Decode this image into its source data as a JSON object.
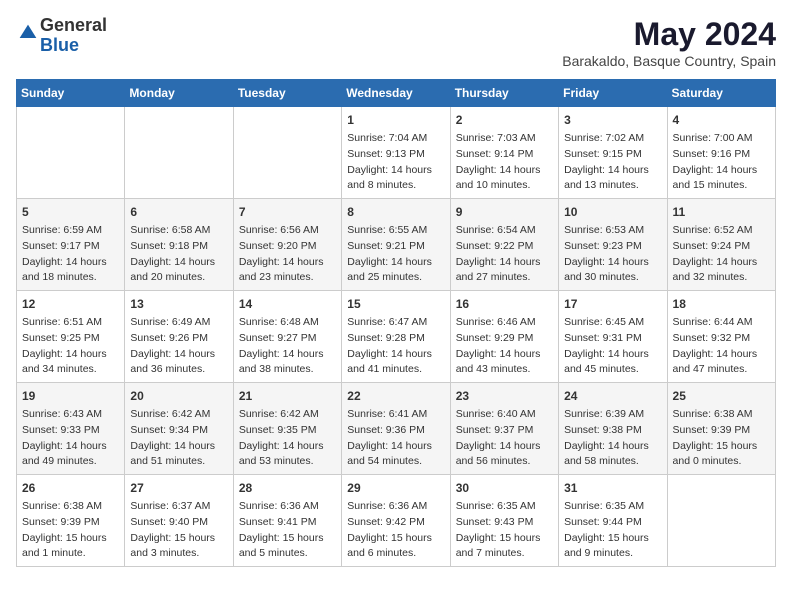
{
  "header": {
    "logo_general": "General",
    "logo_blue": "Blue",
    "title": "May 2024",
    "subtitle": "Barakaldo, Basque Country, Spain"
  },
  "days_of_week": [
    "Sunday",
    "Monday",
    "Tuesday",
    "Wednesday",
    "Thursday",
    "Friday",
    "Saturday"
  ],
  "weeks": [
    [
      {
        "day": "",
        "content": ""
      },
      {
        "day": "",
        "content": ""
      },
      {
        "day": "",
        "content": ""
      },
      {
        "day": "1",
        "content": "Sunrise: 7:04 AM\nSunset: 9:13 PM\nDaylight: 14 hours\nand 8 minutes."
      },
      {
        "day": "2",
        "content": "Sunrise: 7:03 AM\nSunset: 9:14 PM\nDaylight: 14 hours\nand 10 minutes."
      },
      {
        "day": "3",
        "content": "Sunrise: 7:02 AM\nSunset: 9:15 PM\nDaylight: 14 hours\nand 13 minutes."
      },
      {
        "day": "4",
        "content": "Sunrise: 7:00 AM\nSunset: 9:16 PM\nDaylight: 14 hours\nand 15 minutes."
      }
    ],
    [
      {
        "day": "5",
        "content": "Sunrise: 6:59 AM\nSunset: 9:17 PM\nDaylight: 14 hours\nand 18 minutes."
      },
      {
        "day": "6",
        "content": "Sunrise: 6:58 AM\nSunset: 9:18 PM\nDaylight: 14 hours\nand 20 minutes."
      },
      {
        "day": "7",
        "content": "Sunrise: 6:56 AM\nSunset: 9:20 PM\nDaylight: 14 hours\nand 23 minutes."
      },
      {
        "day": "8",
        "content": "Sunrise: 6:55 AM\nSunset: 9:21 PM\nDaylight: 14 hours\nand 25 minutes."
      },
      {
        "day": "9",
        "content": "Sunrise: 6:54 AM\nSunset: 9:22 PM\nDaylight: 14 hours\nand 27 minutes."
      },
      {
        "day": "10",
        "content": "Sunrise: 6:53 AM\nSunset: 9:23 PM\nDaylight: 14 hours\nand 30 minutes."
      },
      {
        "day": "11",
        "content": "Sunrise: 6:52 AM\nSunset: 9:24 PM\nDaylight: 14 hours\nand 32 minutes."
      }
    ],
    [
      {
        "day": "12",
        "content": "Sunrise: 6:51 AM\nSunset: 9:25 PM\nDaylight: 14 hours\nand 34 minutes."
      },
      {
        "day": "13",
        "content": "Sunrise: 6:49 AM\nSunset: 9:26 PM\nDaylight: 14 hours\nand 36 minutes."
      },
      {
        "day": "14",
        "content": "Sunrise: 6:48 AM\nSunset: 9:27 PM\nDaylight: 14 hours\nand 38 minutes."
      },
      {
        "day": "15",
        "content": "Sunrise: 6:47 AM\nSunset: 9:28 PM\nDaylight: 14 hours\nand 41 minutes."
      },
      {
        "day": "16",
        "content": "Sunrise: 6:46 AM\nSunset: 9:29 PM\nDaylight: 14 hours\nand 43 minutes."
      },
      {
        "day": "17",
        "content": "Sunrise: 6:45 AM\nSunset: 9:31 PM\nDaylight: 14 hours\nand 45 minutes."
      },
      {
        "day": "18",
        "content": "Sunrise: 6:44 AM\nSunset: 9:32 PM\nDaylight: 14 hours\nand 47 minutes."
      }
    ],
    [
      {
        "day": "19",
        "content": "Sunrise: 6:43 AM\nSunset: 9:33 PM\nDaylight: 14 hours\nand 49 minutes."
      },
      {
        "day": "20",
        "content": "Sunrise: 6:42 AM\nSunset: 9:34 PM\nDaylight: 14 hours\nand 51 minutes."
      },
      {
        "day": "21",
        "content": "Sunrise: 6:42 AM\nSunset: 9:35 PM\nDaylight: 14 hours\nand 53 minutes."
      },
      {
        "day": "22",
        "content": "Sunrise: 6:41 AM\nSunset: 9:36 PM\nDaylight: 14 hours\nand 54 minutes."
      },
      {
        "day": "23",
        "content": "Sunrise: 6:40 AM\nSunset: 9:37 PM\nDaylight: 14 hours\nand 56 minutes."
      },
      {
        "day": "24",
        "content": "Sunrise: 6:39 AM\nSunset: 9:38 PM\nDaylight: 14 hours\nand 58 minutes."
      },
      {
        "day": "25",
        "content": "Sunrise: 6:38 AM\nSunset: 9:39 PM\nDaylight: 15 hours\nand 0 minutes."
      }
    ],
    [
      {
        "day": "26",
        "content": "Sunrise: 6:38 AM\nSunset: 9:39 PM\nDaylight: 15 hours\nand 1 minute."
      },
      {
        "day": "27",
        "content": "Sunrise: 6:37 AM\nSunset: 9:40 PM\nDaylight: 15 hours\nand 3 minutes."
      },
      {
        "day": "28",
        "content": "Sunrise: 6:36 AM\nSunset: 9:41 PM\nDaylight: 15 hours\nand 5 minutes."
      },
      {
        "day": "29",
        "content": "Sunrise: 6:36 AM\nSunset: 9:42 PM\nDaylight: 15 hours\nand 6 minutes."
      },
      {
        "day": "30",
        "content": "Sunrise: 6:35 AM\nSunset: 9:43 PM\nDaylight: 15 hours\nand 7 minutes."
      },
      {
        "day": "31",
        "content": "Sunrise: 6:35 AM\nSunset: 9:44 PM\nDaylight: 15 hours\nand 9 minutes."
      },
      {
        "day": "",
        "content": ""
      }
    ]
  ]
}
